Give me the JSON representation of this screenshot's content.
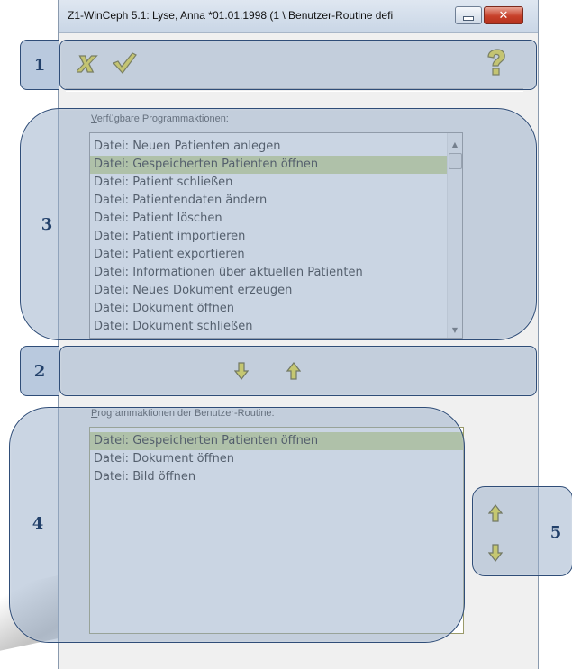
{
  "window": {
    "title": "Z1-WinCeph 5.1: Lyse, Anna *01.01.1998 (1 \\ Benutzer-Routine defi",
    "minimize_icon": "minimize-icon",
    "close_label": "✕"
  },
  "toolbar": {
    "cancel_icon": "cross-icon",
    "ok_icon": "checkmark-icon",
    "help_icon": "question-mark-icon"
  },
  "available": {
    "label_accesskey": "V",
    "label_rest": "erfügbare Programmaktionen:",
    "items": [
      "Datei: Neuen Patienten anlegen",
      "Datei: Gespeicherten Patienten öffnen",
      "Datei: Patient schließen",
      "Datei: Patientendaten ändern",
      "Datei: Patient löschen",
      "Datei: Patient importieren",
      "Datei: Patient exportieren",
      "Datei: Informationen über aktuellen Patienten",
      "Datei: Neues Dokument erzeugen",
      "Datei: Dokument öffnen",
      "Datei: Dokument schließen"
    ],
    "selected_index": 1
  },
  "transfer": {
    "add_icon": "arrow-down-icon",
    "remove_icon": "arrow-up-icon"
  },
  "routine": {
    "label_accesskey": "P",
    "label_rest": "rogrammaktionen der Benutzer-Routine:",
    "items": [
      "Datei: Gespeicherten Patienten öffnen",
      "Datei: Dokument öffnen",
      "Datei: Bild öffnen"
    ],
    "selected_index": 0
  },
  "reorder": {
    "up_icon": "arrow-up-icon",
    "down_icon": "arrow-down-icon"
  },
  "callouts": [
    "1",
    "2",
    "3",
    "4",
    "5"
  ],
  "colors": {
    "overlay": "#96acc8",
    "overlay_border": "#2f4d78",
    "selection": "#c9d68a",
    "arrow_fill": "#f4e21a"
  }
}
